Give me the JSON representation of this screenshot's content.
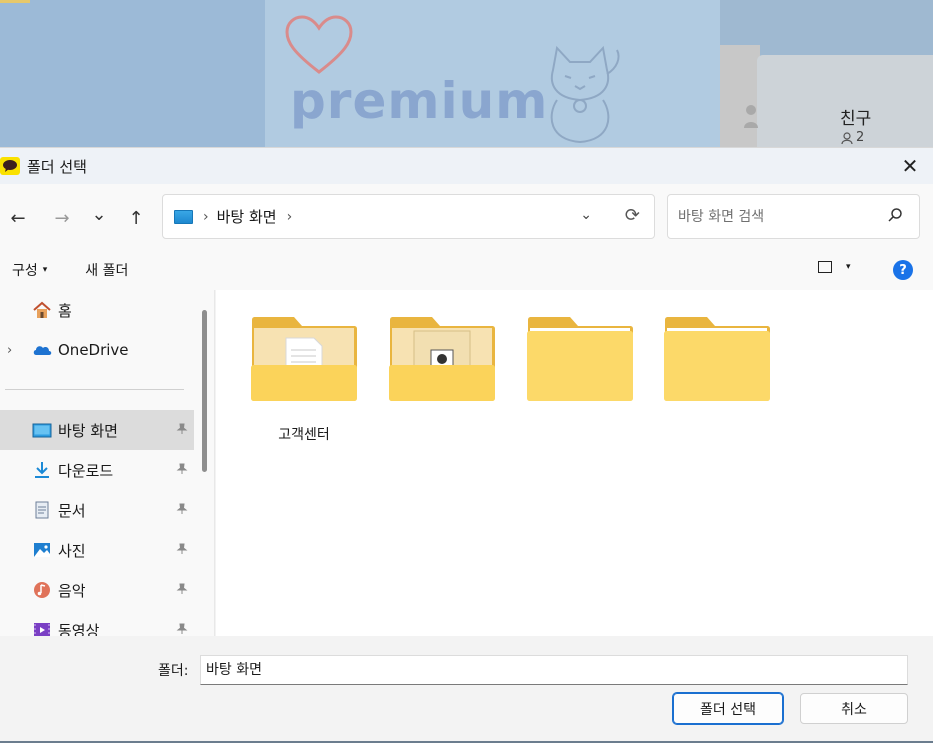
{
  "background": {
    "logo_text": "premium",
    "friends_label": "친구",
    "friends_count": "2"
  },
  "dialog": {
    "title": "폴더 선택",
    "close_glyph": "✕",
    "nav": {
      "back_glyph": "←",
      "forward_glyph": "→",
      "recent_glyph": "⌄",
      "up_glyph": "↑"
    },
    "address": {
      "sep_glyph": "›",
      "location": "바탕 화면",
      "trailing_sep": "›",
      "dropdown_glyph": "⌄",
      "refresh_glyph": "⟳"
    },
    "search": {
      "placeholder": "바탕 화면 검색",
      "icon_glyph": "⚲"
    },
    "toolbar": {
      "compose_label": "구성",
      "compose_caret": "▾",
      "new_folder_label": "새 폴더",
      "view_caret": "▾",
      "help_glyph": "?"
    },
    "sidebar": {
      "items": [
        {
          "label": "홈",
          "icon": "home-icon",
          "expand": "",
          "pinned": false
        },
        {
          "label": "OneDrive",
          "icon": "onedrive-icon",
          "expand": "›",
          "pinned": false
        },
        {
          "label": "바탕 화면",
          "icon": "desktop-icon",
          "expand": "",
          "pinned": true,
          "selected": true
        },
        {
          "label": "다운로드",
          "icon": "download-icon",
          "expand": "",
          "pinned": true
        },
        {
          "label": "문서",
          "icon": "documents-icon",
          "expand": "",
          "pinned": true
        },
        {
          "label": "사진",
          "icon": "pictures-icon",
          "expand": "",
          "pinned": true
        },
        {
          "label": "음악",
          "icon": "music-icon",
          "expand": "",
          "pinned": true
        },
        {
          "label": "동영상",
          "icon": "videos-icon",
          "expand": "",
          "pinned": true
        }
      ],
      "pin_glyph": "📌"
    },
    "files": [
      {
        "name": "고객센터",
        "icon": "folder-with-document-icon"
      },
      {
        "name": "",
        "icon": "folder-with-shortcut-icon"
      },
      {
        "name": "",
        "icon": "folder-icon"
      },
      {
        "name": "",
        "icon": "folder-icon"
      }
    ],
    "footer": {
      "folder_label": "폴더:",
      "folder_value": "바탕 화면",
      "select_button": "폴더 선택",
      "cancel_button": "취소"
    }
  }
}
